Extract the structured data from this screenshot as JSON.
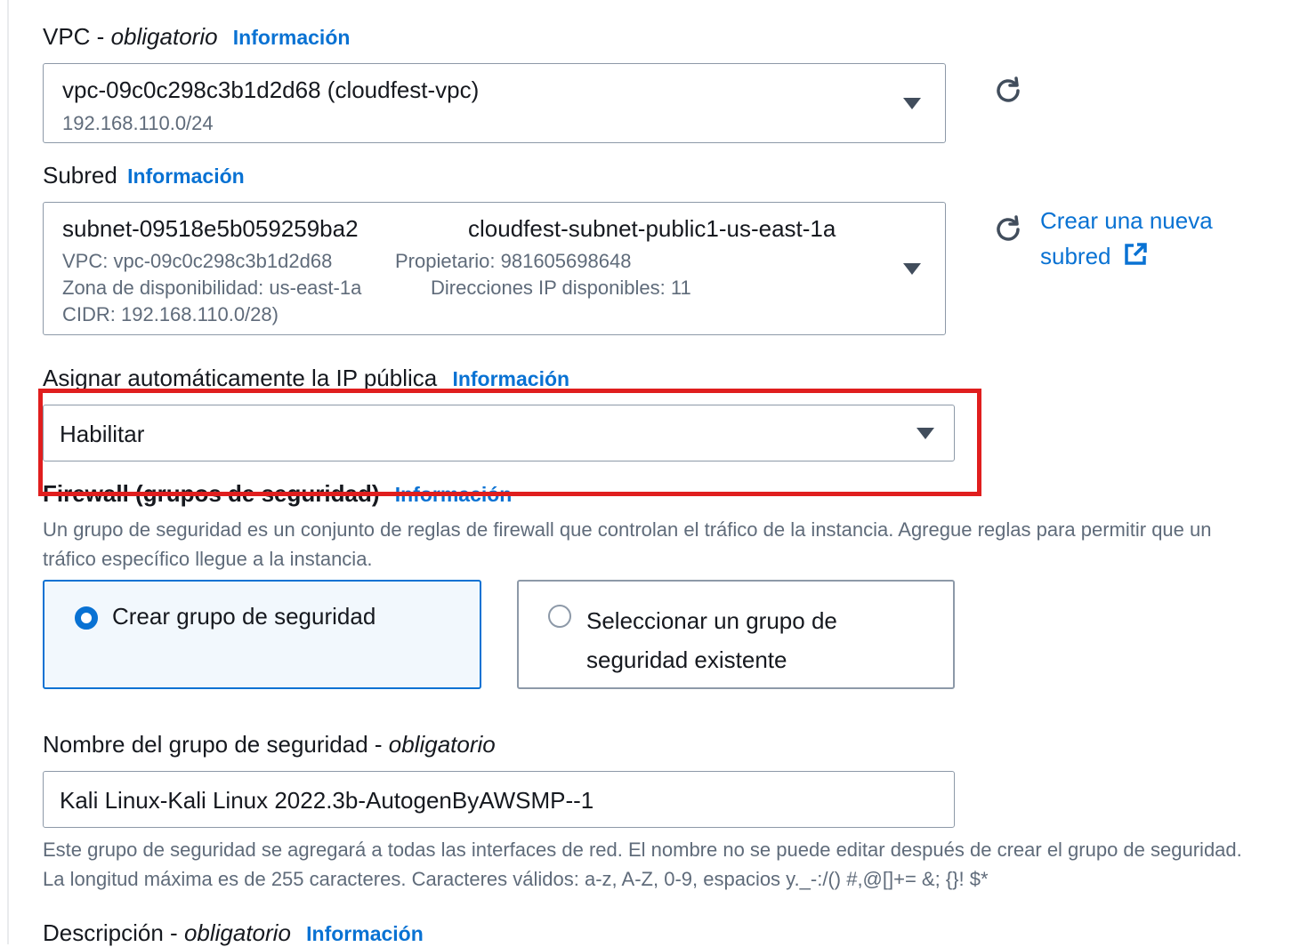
{
  "vpc": {
    "label": "VPC - ",
    "required": "obligatorio",
    "info": "Información",
    "value": "vpc-09c0c298c3b1d2d68 (cloudfest-vpc)",
    "cidr": "192.168.110.0/24"
  },
  "subnet": {
    "label": "Subred",
    "info": "Información",
    "id": "subnet-09518e5b059259ba2",
    "name": "cloudfest-subnet-public1-us-east-1a",
    "vpc": "VPC: vpc-09c0c298c3b1d2d68",
    "owner": "Propietario: 981605698648",
    "az": "Zona de disponibilidad: us-east-1a",
    "available_ips": "Direcciones IP disponibles: 11",
    "cidr": "CIDR: 192.168.110.0/28)",
    "create_link_line1": "Crear una nueva",
    "create_link_line2": "subred"
  },
  "public_ip": {
    "label": "Asignar automáticamente la IP pública",
    "info": "Información",
    "value": "Habilitar"
  },
  "firewall": {
    "label": "Firewall (grupos de seguridad)",
    "info": "Información",
    "description": "Un grupo de seguridad es un conjunto de reglas de firewall que controlan el tráfico de la instancia. Agregue reglas para permitir que un tráfico específico llegue a la instancia.",
    "options": [
      {
        "label": "Crear grupo de seguridad",
        "selected": true
      },
      {
        "label_line1": "Seleccionar un grupo de",
        "label_line2": "seguridad existente",
        "selected": false
      }
    ]
  },
  "sg_name": {
    "label": "Nombre del grupo de seguridad - ",
    "required": "obligatorio",
    "value": "Kali Linux-Kali Linux 2022.3b-AutogenByAWSMP--1",
    "help": "Este grupo de seguridad se agregará a todas las interfaces de red. El nombre no se puede editar después de crear el grupo de seguridad. La longitud máxima es de 255 caracteres. Caracteres válidos: a-z, A-Z, 0-9, espacios y._-:/() #,@[]+= &; {}! $*"
  },
  "description": {
    "label": "Descripción - ",
    "required": "obligatorio",
    "info": "Información"
  },
  "colors": {
    "link": "#0972d3",
    "border": "#8d99a8",
    "selected_bg": "#f2f8fd",
    "selected_border": "#0972d3",
    "highlight": "#e01e1e"
  }
}
